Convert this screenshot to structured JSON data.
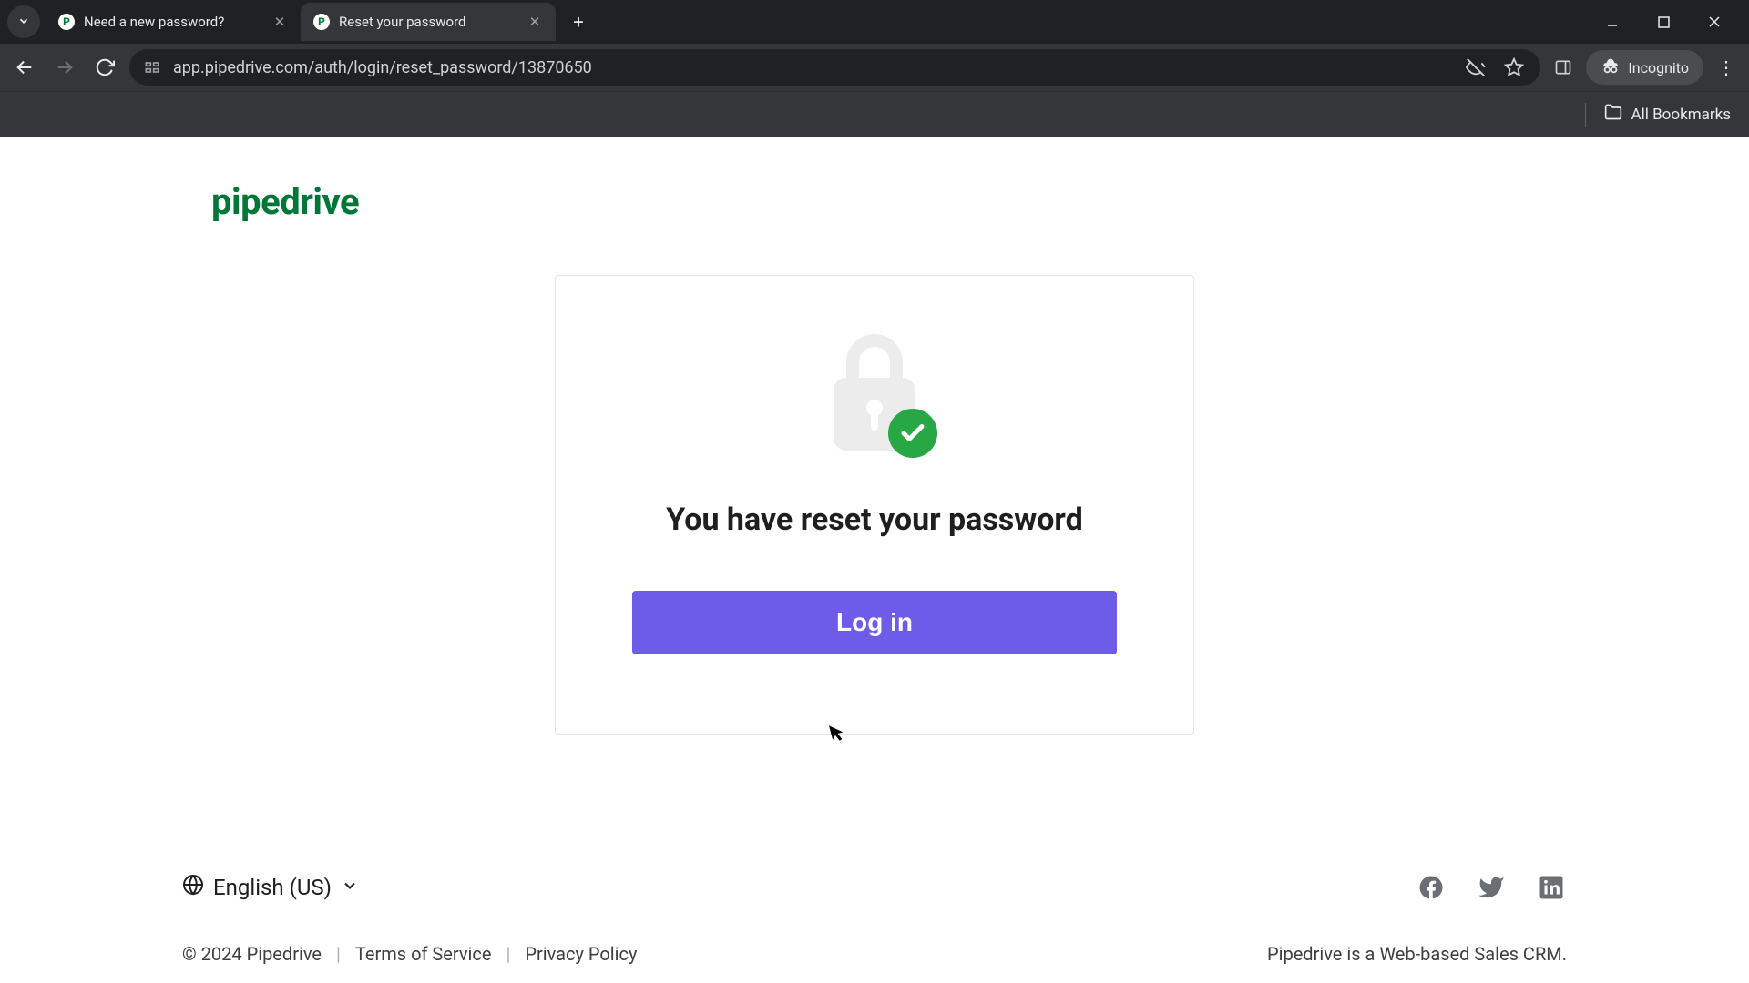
{
  "browser": {
    "tabs": [
      {
        "title": "Need a new password?",
        "favicon": "P",
        "active": false
      },
      {
        "title": "Reset your password",
        "favicon": "P",
        "active": true
      }
    ],
    "url": "app.pipedrive.com/auth/login/reset_password/13870650",
    "incognito_label": "Incognito",
    "all_bookmarks": "All Bookmarks"
  },
  "page": {
    "logo_text": "pipedrive",
    "heading": "You have reset your password",
    "login_button": "Log in"
  },
  "footer": {
    "language": "English (US)",
    "copyright": "© 2024 Pipedrive",
    "terms": "Terms of Service",
    "privacy": "Privacy Policy",
    "tagline": "Pipedrive is a Web-based Sales CRM."
  },
  "colors": {
    "brand_green": "#017737",
    "accent_purple": "#6c5ce7",
    "success_green": "#28a745"
  }
}
